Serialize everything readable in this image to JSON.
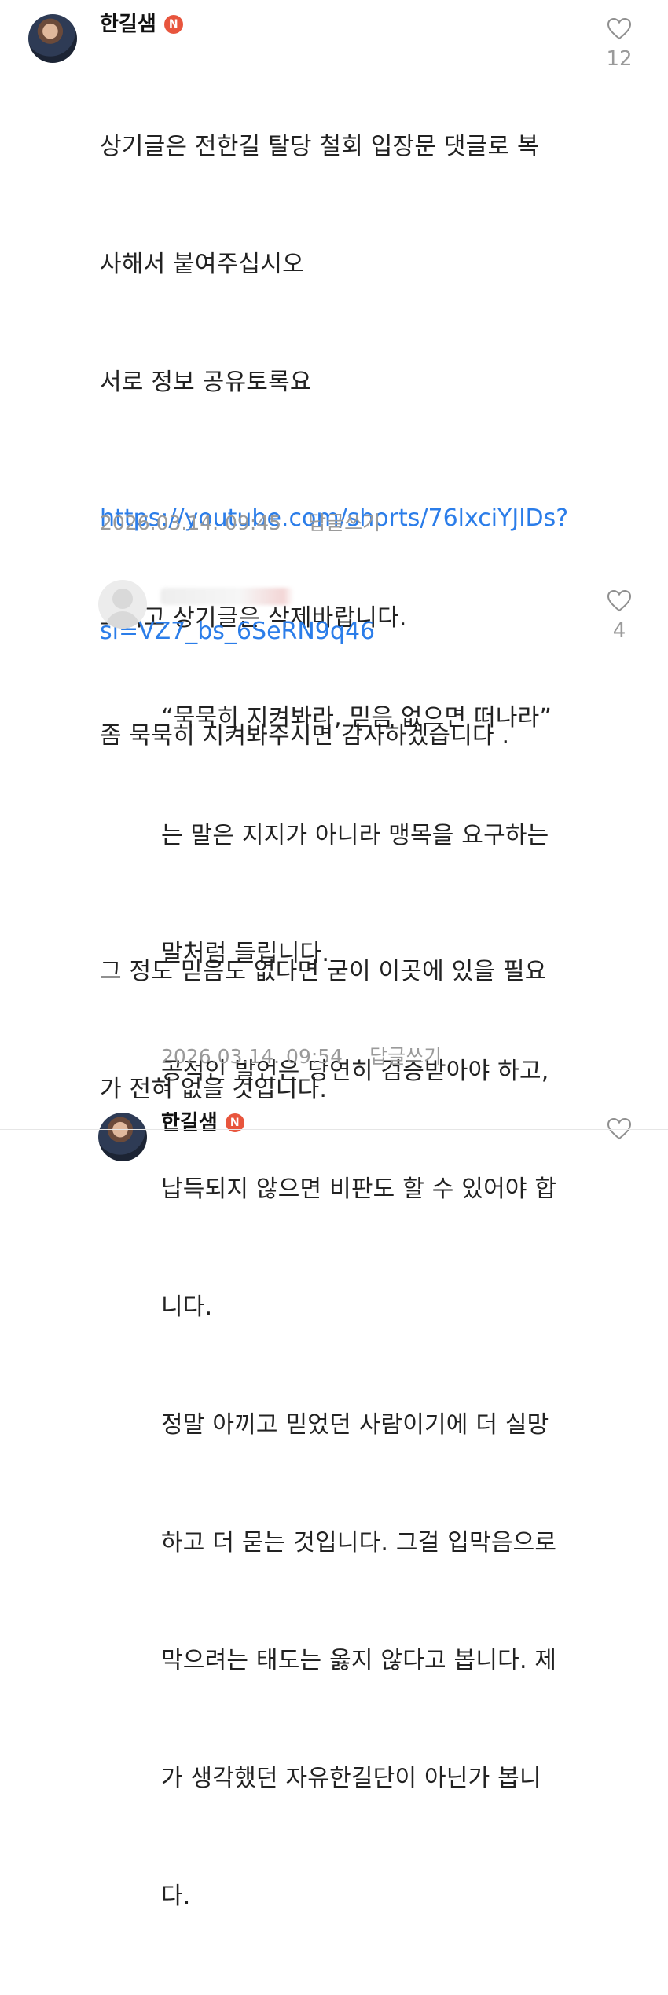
{
  "comments": [
    {
      "author": "한길샘",
      "badge": "N",
      "body_lines": [
        "상기글은 전한길 탈당 철회 입장문 댓글로 복",
        "사해서 붙여주십시오",
        "서로 정보 공유토록요",
        "",
        "그리고 상기글은 삭제바랍니다.",
        "좀 묵묵히 지켜봐주시면 감사하겠습니다 .",
        "",
        "그 정도 믿음도 없다면 굳이 이곳에 있을 필요",
        "가 전혀 없을 것입니다."
      ],
      "link_lines": [
        "https://youtube.com/shorts/76lxciYJlDs?",
        "si=VZ7_bs_6SeRN9q46"
      ],
      "timestamp": "2026.03.14. 09:45",
      "reply_label": "답글쓰기",
      "likes": "12",
      "icon": "heart-outline-icon"
    },
    {
      "author": "",
      "body_lines": [
        "“묵묵히 지켜봐라, 믿음 없으면 떠나라”",
        "는 말은 지지가 아니라 맹목을 요구하는",
        "말처럼 들립니다.",
        "공적인 발언은 당연히 검증받아야 하고,",
        "납득되지 않으면 비판도 할 수 있어야 합",
        "니다.",
        "정말 아끼고 믿었던 사람이기에 더 실망",
        "하고 더 묻는 것입니다. 그걸 입막음으로",
        "막으려는 태도는 옳지 않다고 봅니다. 제",
        "가 생각했던 자유한길단이 아닌가 봅니",
        "다."
      ],
      "timestamp": "2026.03.14. 09:54",
      "reply_label": "답글쓰기",
      "likes": "4",
      "icon": "heart-outline-icon"
    },
    {
      "author": "한길샘",
      "badge": "N"
    }
  ]
}
